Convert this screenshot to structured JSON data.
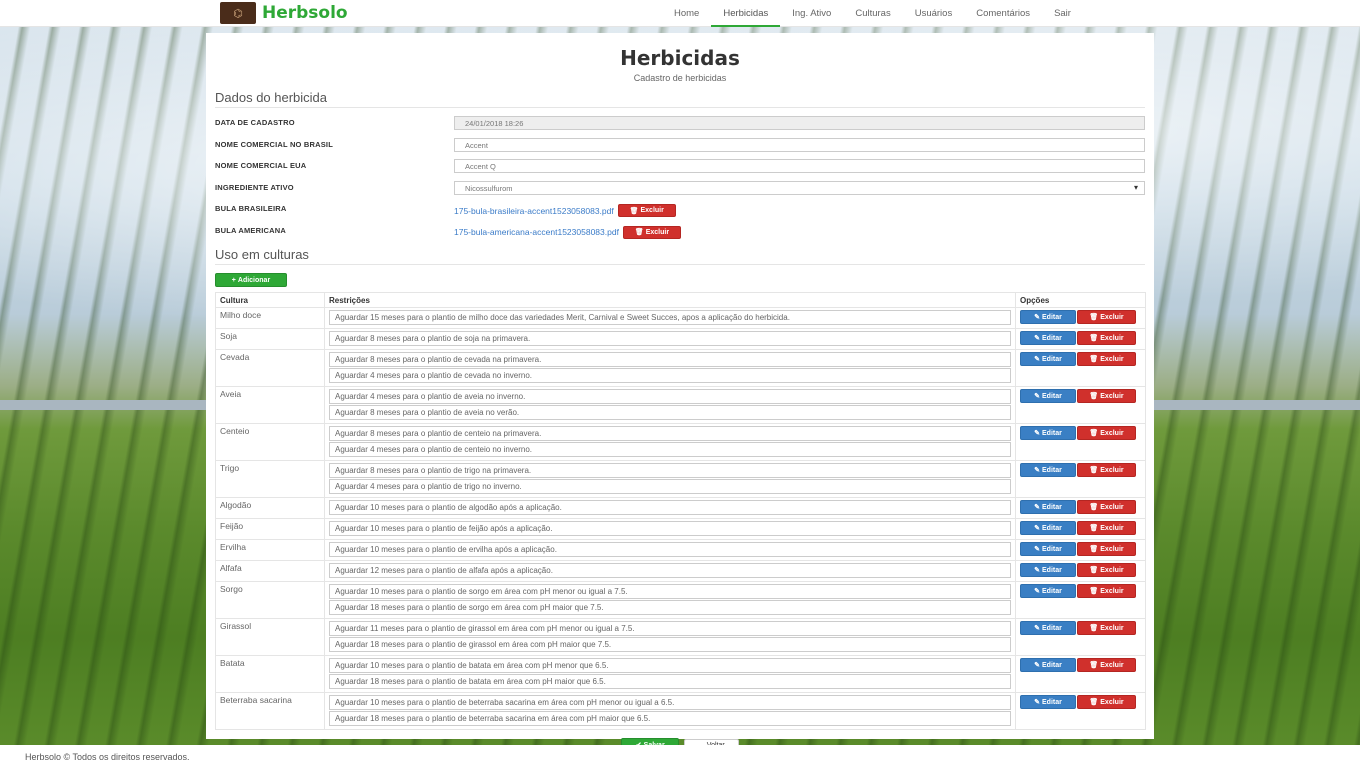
{
  "brand": {
    "name": "Herbsolo"
  },
  "nav": {
    "items": [
      {
        "label": "Home"
      },
      {
        "label": "Herbicidas"
      },
      {
        "label": "Ing. Ativo"
      },
      {
        "label": "Culturas"
      },
      {
        "label": "Usuários"
      },
      {
        "label": "Comentários"
      },
      {
        "label": "Sair"
      }
    ],
    "active": "Herbicidas"
  },
  "page": {
    "title": "Herbicidas",
    "subtitle": "Cadastro de herbicidas"
  },
  "form": {
    "section_title": "Dados do herbicida",
    "data_cadastro": {
      "label": "DATA DE CADASTRO",
      "value": "24/01/2018 18:26"
    },
    "nome_brasil": {
      "label": "NOME COMERCIAL NO BRASIL",
      "value": "Accent"
    },
    "nome_eua": {
      "label": "NOME COMERCIAL EUA",
      "value": "Accent Q"
    },
    "ingrediente": {
      "label": "INGREDIENTE ATIVO",
      "value": "Nicossulfurom"
    },
    "bula_brasileira": {
      "label": "BULA BRASILEIRA",
      "file": "175-bula-brasileira-accent1523058083.pdf",
      "delete_label": "Excluir"
    },
    "bula_americana": {
      "label": "BULA AMERICANA",
      "file": "175-bula-americana-accent1523058083.pdf",
      "delete_label": "Excluir"
    }
  },
  "uses": {
    "section_title": "Uso em culturas",
    "add_label": "Adicionar",
    "headers": {
      "cultura": "Cultura",
      "restricoes": "Restrições",
      "opcoes": "Opções"
    },
    "edit_label": "Editar",
    "delete_label": "Excluir",
    "rows": [
      {
        "cultura": "Milho doce",
        "restricoes": [
          "Aguardar 15 meses para o plantio de milho doce das variedades Merit, Carnival e Sweet Succes, apos a aplicação do herbicida."
        ]
      },
      {
        "cultura": "Soja",
        "restricoes": [
          "Aguardar 8 meses para o plantio de soja na primavera."
        ]
      },
      {
        "cultura": "Cevada",
        "restricoes": [
          "Aguardar 8 meses para o plantio de cevada na primavera.",
          "Aguardar 4 meses para o plantio de cevada no inverno."
        ]
      },
      {
        "cultura": "Aveia",
        "restricoes": [
          "Aguardar 4 meses para o plantio de aveia no inverno.",
          "Aguardar 8 meses para o plantio de aveia no verão."
        ]
      },
      {
        "cultura": "Centeio",
        "restricoes": [
          "Aguardar 8 meses para o plantio de centeio na primavera.",
          "Aguardar 4 meses para o plantio de centeio no inverno."
        ]
      },
      {
        "cultura": "Trigo",
        "restricoes": [
          "Aguardar 8 meses para o plantio de trigo na primavera.",
          "Aguardar 4 meses para o plantio de trigo no inverno."
        ]
      },
      {
        "cultura": "Algodão",
        "restricoes": [
          "Aguardar 10 meses para o plantio de algodão após a aplicação."
        ]
      },
      {
        "cultura": "Feijão",
        "restricoes": [
          "Aguardar 10 meses para o plantio de feijão após a aplicação."
        ]
      },
      {
        "cultura": "Ervilha",
        "restricoes": [
          "Aguardar 10 meses para o plantio de ervilha após a aplicação."
        ]
      },
      {
        "cultura": "Alfafa",
        "restricoes": [
          "Aguardar 12 meses para o plantio de alfafa após a aplicação."
        ]
      },
      {
        "cultura": "Sorgo",
        "restricoes": [
          "Aguardar 10 meses para o plantio de sorgo em área com pH menor ou igual a 7.5.",
          "Aguardar 18 meses para o plantio de sorgo em área com pH maior que 7.5."
        ]
      },
      {
        "cultura": "Girassol",
        "restricoes": [
          "Aguardar 11 meses para o plantio de girassol em área com pH menor ou igual a 7.5.",
          "Aguardar 18 meses para o plantio de girassol em área com pH maior que 7.5."
        ]
      },
      {
        "cultura": "Batata",
        "restricoes": [
          "Aguardar 10 meses para o plantio de batata em área com pH menor que 6.5.",
          "Aguardar 18 meses para o plantio de batata em área com pH maior que 6.5."
        ]
      },
      {
        "cultura": "Beterraba sacarina",
        "restricoes": [
          "Aguardar 10 meses para o plantio de beterraba sacarina em área com pH menor ou igual a 6.5.",
          "Aguardar 18 meses para o plantio de beterraba sacarina em área com pH maior que 6.5."
        ]
      }
    ]
  },
  "actions": {
    "save_label": "Salvar",
    "back_label": "Voltar"
  },
  "footer": {
    "text": "Herbsolo © Todos os direitos reservados."
  },
  "colors": {
    "brand_green": "#2ea836",
    "primary": "#3a7fc4",
    "danger": "#d0302c"
  }
}
